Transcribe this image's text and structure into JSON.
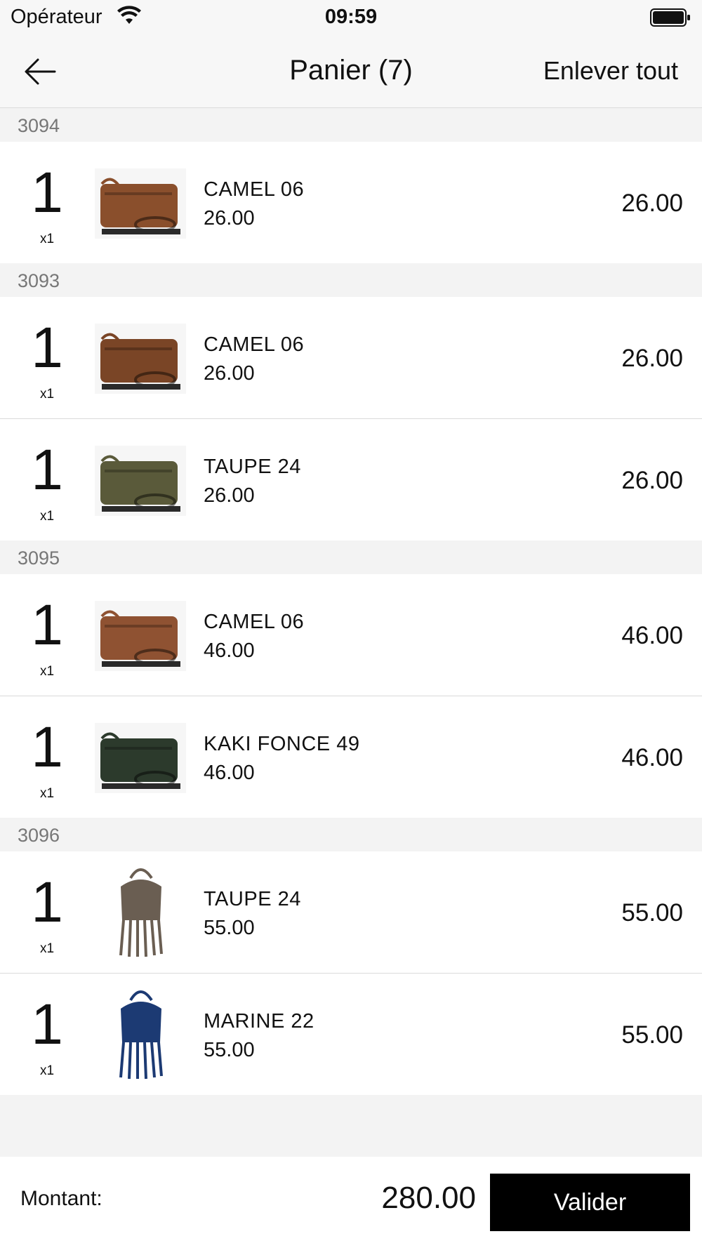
{
  "status_bar": {
    "carrier": "Opérateur",
    "time": "09:59",
    "wifi_icon": "wifi-icon",
    "battery_icon": "battery-icon"
  },
  "nav": {
    "back_icon": "arrow-left-icon",
    "title": "Panier (7)",
    "clear_label": "Enlever tout"
  },
  "sections": [
    {
      "header": "3094",
      "items": [
        {
          "qty": "1",
          "qty_sub": "x1",
          "name": "CAMEL 06",
          "unit_price": "26.00",
          "price": "26.00",
          "image": "camel-bag-thumbnail",
          "color": "#8a4f2c"
        }
      ]
    },
    {
      "header": "3093",
      "items": [
        {
          "qty": "1",
          "qty_sub": "x1",
          "name": "CAMEL 06",
          "unit_price": "26.00",
          "price": "26.00",
          "image": "camel-bag-thumbnail",
          "color": "#7a4526"
        },
        {
          "qty": "1",
          "qty_sub": "x1",
          "name": "TAUPE 24",
          "unit_price": "26.00",
          "price": "26.00",
          "image": "taupe-bag-thumbnail",
          "color": "#5a5a3a"
        }
      ]
    },
    {
      "header": "3095",
      "items": [
        {
          "qty": "1",
          "qty_sub": "x1",
          "name": "CAMEL 06",
          "unit_price": "46.00",
          "price": "46.00",
          "image": "camel-bag-thumbnail",
          "color": "#8f5232"
        },
        {
          "qty": "1",
          "qty_sub": "x1",
          "name": "KAKI FONCE 49",
          "unit_price": "46.00",
          "price": "46.00",
          "image": "kaki-bag-thumbnail",
          "color": "#2c3a2c"
        }
      ]
    },
    {
      "header": "3096",
      "items": [
        {
          "qty": "1",
          "qty_sub": "x1",
          "name": "TAUPE 24",
          "unit_price": "55.00",
          "price": "55.00",
          "image": "taupe-fringe-bag-thumbnail",
          "color": "#6a5e52"
        },
        {
          "qty": "1",
          "qty_sub": "x1",
          "name": "MARINE 22",
          "unit_price": "55.00",
          "price": "55.00",
          "image": "marine-fringe-bag-thumbnail",
          "color": "#1c3a73"
        }
      ]
    }
  ],
  "footer": {
    "label": "Montant:",
    "total": "280.00",
    "validate_label": "Valider"
  },
  "colors": {
    "background": "#f3f3f3",
    "bar": "#f7f7f7",
    "primary_button": "#000000",
    "section_text": "#777777"
  }
}
